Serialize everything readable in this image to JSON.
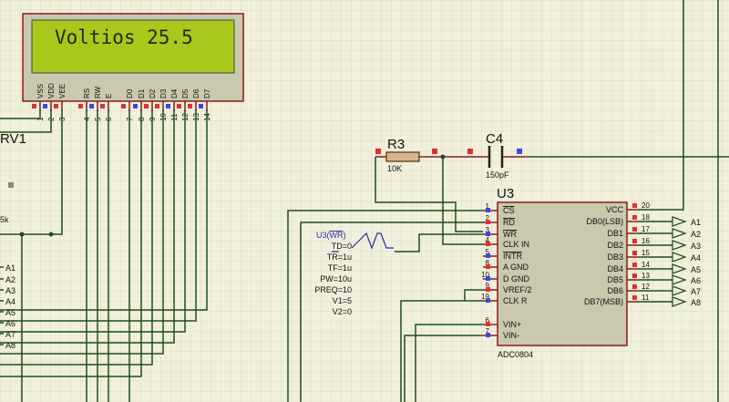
{
  "lcd": {
    "display_text": "Voltios 25.5",
    "pins": [
      {
        "name": "VSS",
        "num": "1"
      },
      {
        "name": "VDD",
        "num": "2"
      },
      {
        "name": "VEE",
        "num": "3"
      },
      {
        "name": "RS",
        "num": "4"
      },
      {
        "name": "RW",
        "num": "5"
      },
      {
        "name": "E",
        "num": "6"
      },
      {
        "name": "D0",
        "num": "7"
      },
      {
        "name": "D1",
        "num": "8"
      },
      {
        "name": "D2",
        "num": "9"
      },
      {
        "name": "D3",
        "num": "10"
      },
      {
        "name": "D4",
        "num": "11"
      },
      {
        "name": "D5",
        "num": "12"
      },
      {
        "name": "D6",
        "num": "13"
      },
      {
        "name": "D7",
        "num": "14"
      }
    ]
  },
  "rv1": {
    "ref": "RV1",
    "value": "5k"
  },
  "r3": {
    "ref": "R3",
    "value": "10K"
  },
  "c4": {
    "ref": "C4",
    "value": "150pF"
  },
  "u3": {
    "ref": "U3",
    "part": "ADC0804",
    "left_pins": [
      {
        "num": "1",
        "name": "CS",
        "overline": true
      },
      {
        "num": "2",
        "name": "RD",
        "overline": true
      },
      {
        "num": "3",
        "name": "WR",
        "overline": true
      },
      {
        "num": "4",
        "name": "CLK IN",
        "overline": false
      },
      {
        "num": "5",
        "name": "INTR",
        "overline": true
      },
      {
        "num": "8",
        "name": "A GND",
        "overline": false
      },
      {
        "num": "10",
        "name": "D GND",
        "overline": false
      },
      {
        "num": "9",
        "name": "VREF/2",
        "overline": false
      },
      {
        "num": "19",
        "name": "CLK R",
        "overline": false
      },
      {
        "num": "6",
        "name": "VIN+",
        "overline": false
      },
      {
        "num": "7",
        "name": "VIN-",
        "overline": false
      }
    ],
    "right_pins": [
      {
        "num": "20",
        "name": "VCC"
      },
      {
        "num": "18",
        "name": "DB0(LSB)"
      },
      {
        "num": "17",
        "name": "DB1"
      },
      {
        "num": "16",
        "name": "DB2"
      },
      {
        "num": "15",
        "name": "DB3"
      },
      {
        "num": "14",
        "name": "DB4"
      },
      {
        "num": "13",
        "name": "DB5"
      },
      {
        "num": "12",
        "name": "DB6"
      },
      {
        "num": "11",
        "name": "DB7(MSB)"
      }
    ]
  },
  "pulse": {
    "title_prefix": "U3(",
    "title_signal": "WR",
    "title_suffix": ")",
    "params": [
      "TD=0",
      "TR=1u",
      "TF=1u",
      "PW=10u",
      "PREQ=10",
      "V1=5",
      "V2=0"
    ]
  },
  "out_labels": [
    "A1",
    "A2",
    "A3",
    "A4",
    "A5",
    "A6",
    "A7",
    "A8"
  ],
  "left_labels": [
    "A1",
    "A2",
    "A3",
    "A4",
    "A5",
    "A6",
    "A7",
    "A8"
  ]
}
